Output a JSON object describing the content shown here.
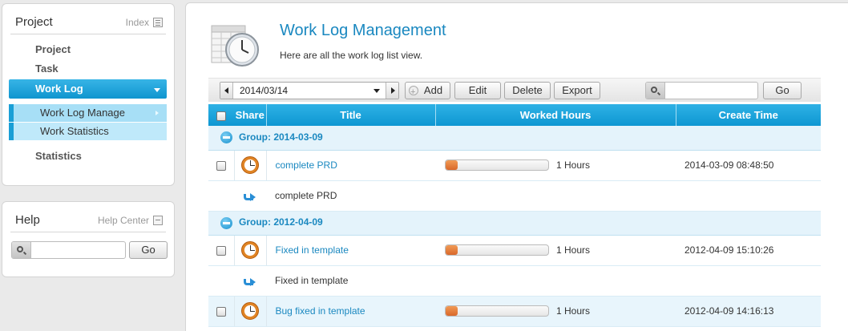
{
  "sidebar": {
    "project_panel": {
      "title": "Project",
      "index_link": "Index",
      "items": [
        {
          "label": "Project"
        },
        {
          "label": "Task"
        },
        {
          "label": "Work Log",
          "active": true
        }
      ],
      "subitems": [
        {
          "label": "Work Log Manage",
          "selected": true
        },
        {
          "label": "Work Statistics"
        }
      ],
      "extra_item": "Statistics"
    },
    "help_panel": {
      "title": "Help",
      "help_center": "Help Center",
      "search_placeholder": "",
      "go_label": "Go"
    }
  },
  "main": {
    "title": "Work Log Management",
    "subtitle": "Here are all the work log list view.",
    "toolbar": {
      "date": "2014/03/14",
      "add_label": "Add",
      "edit_label": "Edit",
      "delete_label": "Delete",
      "export_label": "Export",
      "search_placeholder": "",
      "go_label": "Go"
    },
    "table": {
      "headers": {
        "share": "Share",
        "title": "Title",
        "worked_hours": "Worked Hours",
        "create_time": "Create Time"
      },
      "groups": [
        {
          "label": "Group: 2014-03-09",
          "rows": [
            {
              "title": "complete PRD",
              "hours_fraction": 0.12,
              "hours_text": "1 Hours",
              "created": "2014-03-09 08:48:50",
              "detail": "complete PRD"
            }
          ]
        },
        {
          "label": "Group: 2012-04-09",
          "rows": [
            {
              "title": "Fixed in template",
              "hours_fraction": 0.12,
              "hours_text": "1 Hours",
              "created": "2012-04-09 15:10:26",
              "detail": "Fixed in template"
            },
            {
              "title": "Bug fixed in template",
              "hours_fraction": 0.12,
              "hours_text": "1 Hours",
              "created": "2012-04-09 14:16:13"
            }
          ]
        }
      ]
    }
  },
  "colors": {
    "accent": "#1a9fd6",
    "title_blue": "#1a88c0",
    "progress_orange": "#e07a34"
  },
  "icons": {
    "header": "calendar-clock-icon",
    "row": "clock-icon",
    "group_toggle": "collapse-minus-icon",
    "detail": "reply-arrow-icon",
    "search": "search-icon"
  }
}
